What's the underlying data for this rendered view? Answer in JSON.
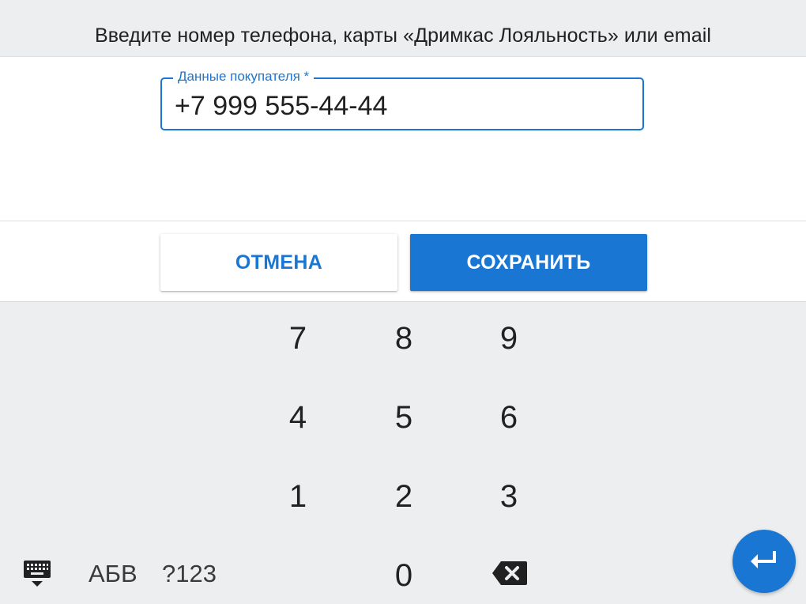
{
  "header": {
    "title": "Введите номер телефона, карты «Дримкас Лояльность» или email"
  },
  "field": {
    "label": "Данные покупателя *",
    "value": "+7 999 555-44-44"
  },
  "buttons": {
    "cancel_label": "ОТМЕНА",
    "save_label": "СОХРАНИТЬ"
  },
  "keyboard": {
    "row1": [
      "7",
      "8",
      "9"
    ],
    "row2": [
      "4",
      "5",
      "6"
    ],
    "row3": [
      "1",
      "2",
      "3"
    ],
    "zero": "0",
    "letters_label": "АБВ",
    "symbols_label": "?123",
    "icons": {
      "keyboard_toggle": "keyboard-hide-icon",
      "backspace": "backspace-icon",
      "enter": "enter-icon"
    }
  },
  "colors": {
    "accent": "#1976d2",
    "header_bg": "#eceeef",
    "keyboard_bg": "#eceeef"
  }
}
